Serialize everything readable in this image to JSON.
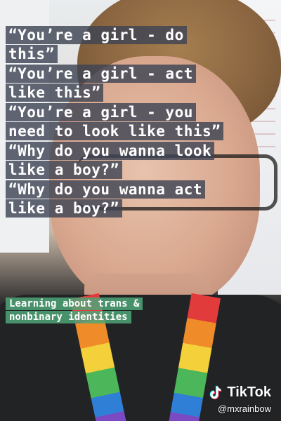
{
  "caption": {
    "lines": [
      "“You’re a girl - do this”",
      "“You’re a girl - act like this”",
      "“You’re a girl - you need to look like this”",
      "“Why do you wanna look like a boy?”",
      "“Why do you wanna act like a boy?”"
    ]
  },
  "badge": {
    "text": "Learning about trans & nonbinary identities"
  },
  "branding": {
    "logo_text": "TikTok",
    "handle": "@mxrainbow",
    "logo_icon": "tiktok-note-icon"
  },
  "colors": {
    "caption_bg": "#3e4454",
    "badge_bg": "#4da678",
    "text": "#ffffff"
  }
}
